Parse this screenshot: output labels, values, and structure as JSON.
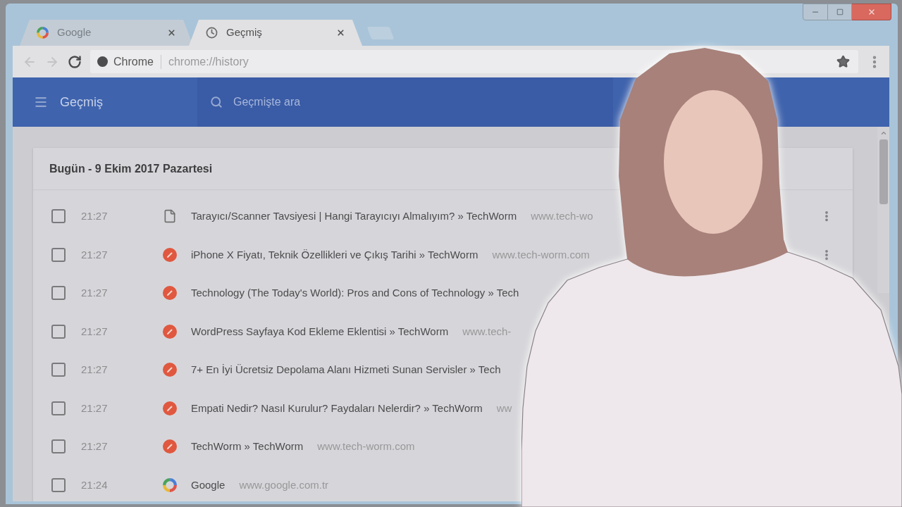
{
  "window": {
    "tabs": [
      {
        "label": "Google",
        "kind": "google",
        "selected": false
      },
      {
        "label": "Geçmiş",
        "kind": "history",
        "selected": true
      }
    ]
  },
  "toolbar": {
    "nav": [
      {
        "kind": "back",
        "disabled": true
      },
      {
        "kind": "forward",
        "disabled": true
      },
      {
        "kind": "reload",
        "disabled": false
      }
    ],
    "site_chip": "Chrome",
    "url": "chrome://history"
  },
  "header": {
    "title": "Geçmiş",
    "search": {
      "placeholder": "Geçmişte ara"
    }
  },
  "history": {
    "date_heading": "Bugün - 9 Ekim 2017 Pazartesi",
    "rows": [
      {
        "time": "21:27",
        "kind": "document",
        "title": "Tarayıcı/Scanner Tavsiyesi | Hangi Tarayıcıyı Almalıyım? » TechWorm",
        "url": "www.tech-wo",
        "checked": false,
        "menu": true
      },
      {
        "time": "21:27",
        "kind": "site",
        "title": "iPhone X Fiyatı, Teknik Özellikleri ve Çıkış Tarihi » TechWorm",
        "url": "www.tech-worm.com",
        "checked": false,
        "menu": true
      },
      {
        "time": "21:27",
        "kind": "site",
        "title": "Technology (The Today's World): Pros and Cons of Technology » Tech",
        "checked": false
      },
      {
        "time": "21:27",
        "kind": "site",
        "title": "WordPress Sayfaya Kod Ekleme Eklentisi » TechWorm",
        "url": "www.tech-",
        "checked": false
      },
      {
        "time": "21:27",
        "kind": "site",
        "title": "7+ En İyi Ücretsiz Depolama Alanı Hizmeti Sunan Servisler » Tech",
        "checked": false
      },
      {
        "time": "21:27",
        "kind": "site",
        "title": "Empati Nedir? Nasıl Kurulur? Faydaları Nelerdir? » TechWorm",
        "url": "ww",
        "checked": false
      },
      {
        "time": "21:27",
        "kind": "site",
        "title": "TechWorm » TechWorm",
        "url": "www.tech-worm.com",
        "checked": false
      },
      {
        "time": "21:24",
        "kind": "google",
        "title": "Google",
        "url": "www.google.com.tr",
        "checked": false
      }
    ]
  }
}
